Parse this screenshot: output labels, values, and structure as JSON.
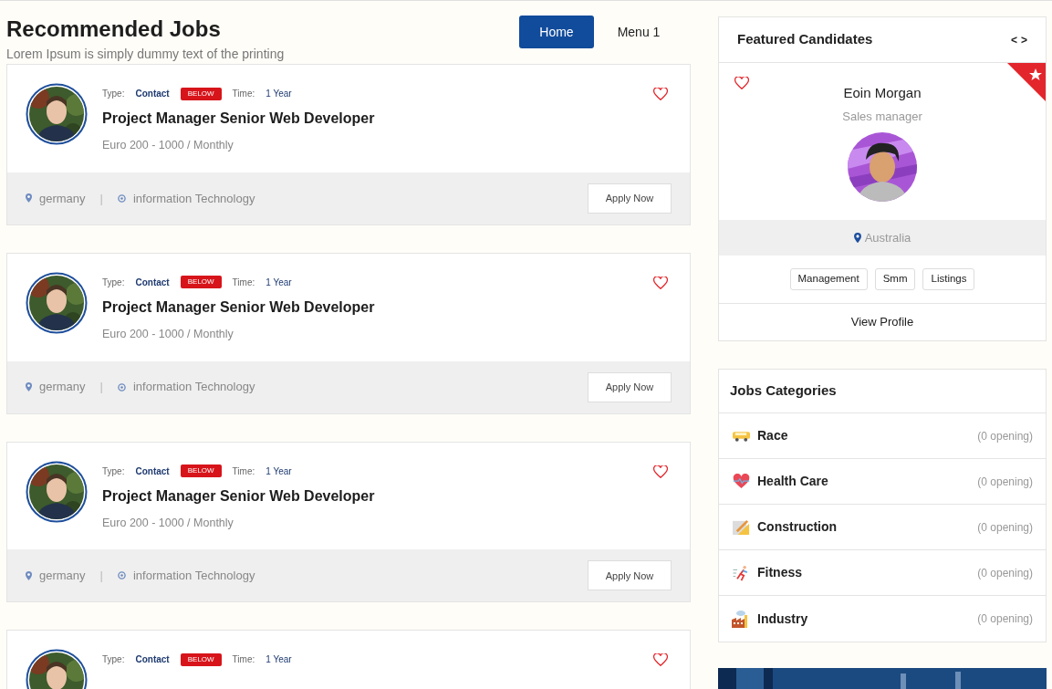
{
  "header": {
    "title": "Recommended Jobs",
    "subtitle": "Lorem Ipsum is simply dummy text of the printing"
  },
  "nav": [
    {
      "label": "Home",
      "selected": true
    },
    {
      "label": "Menu 1",
      "selected": false
    }
  ],
  "jobs": [
    {
      "type_label": "Type:",
      "type": "Contact",
      "badge": "BELOW",
      "time_label": "Time:",
      "time": "1 Year",
      "title": "Project Manager Senior Web Developer",
      "salary": "Euro 200 - 1000 / Monthly",
      "location": "germany",
      "separator": "|",
      "category": "information Technology",
      "apply": "Apply Now"
    },
    {
      "type_label": "Type:",
      "type": "Contact",
      "badge": "BELOW",
      "time_label": "Time:",
      "time": "1 Year",
      "title": "Project Manager Senior Web Developer",
      "salary": "Euro 200 - 1000 / Monthly",
      "location": "germany",
      "separator": "|",
      "category": "information Technology",
      "apply": "Apply Now"
    },
    {
      "type_label": "Type:",
      "type": "Contact",
      "badge": "BELOW",
      "time_label": "Time:",
      "time": "1 Year",
      "title": "Project Manager Senior Web Developer",
      "salary": "Euro 200 - 1000 / Monthly",
      "location": "germany",
      "separator": "|",
      "category": "information Technology",
      "apply": "Apply Now"
    },
    {
      "type_label": "Type:",
      "type": "Contact",
      "badge": "BELOW",
      "time_label": "Time:",
      "time": "1 Year"
    }
  ],
  "featured": {
    "title": "Featured Candidates",
    "prev": "<",
    "next": ">",
    "name": "Eoin Morgan",
    "role": "Sales manager",
    "location": "Australia",
    "tags": [
      "Management",
      "Smm",
      "Listings"
    ],
    "action": "View Profile"
  },
  "categories": {
    "title": "Jobs Categories",
    "items": [
      {
        "name": "Race",
        "count": "(0 opening)"
      },
      {
        "name": "Health Care",
        "count": "(0 opening)"
      },
      {
        "name": "Construction",
        "count": "(0 opening)"
      },
      {
        "name": "Fitness",
        "count": "(0 opening)"
      },
      {
        "name": "Industry",
        "count": "(0 opening)"
      }
    ]
  }
}
